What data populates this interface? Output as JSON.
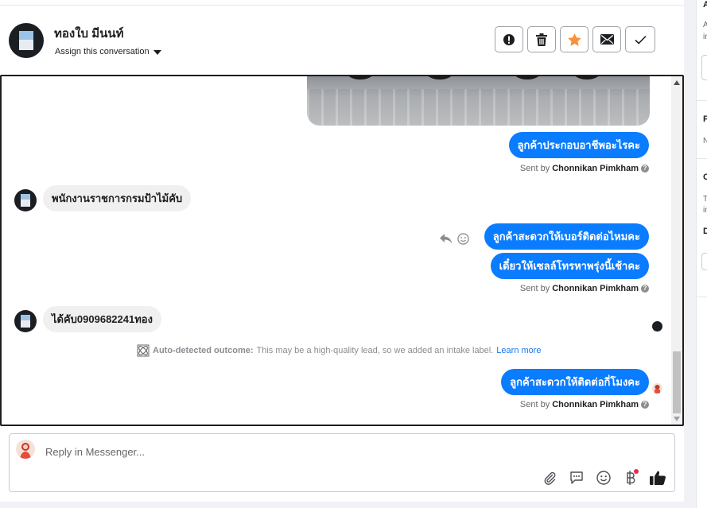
{
  "header": {
    "contact_name": "ทองใบ มีนนท์",
    "assign_label": "Assign this conversation",
    "actions": [
      {
        "name": "report-spam-button",
        "icon": "alert-circle-icon"
      },
      {
        "name": "delete-button",
        "icon": "trash-icon"
      },
      {
        "name": "star-button",
        "icon": "star-icon"
      },
      {
        "name": "mark-unread-button",
        "icon": "envelope-icon"
      },
      {
        "name": "mark-done-button",
        "icon": "check-icon"
      }
    ]
  },
  "messages": {
    "m1": "ลูกค้าประกอบอาชีพอะไรคะ",
    "m2": "พนักงานราชการกรมป้าไม้คับ",
    "m3": "ลูกค้าสะดวกให้เบอร์ติดต่อไหมคะ",
    "m4": "เดี๋ยวให้เซลล์โทรหาพรุ่งนี้เช้าคะ",
    "m5": "ได้คับ0909682241ทอง",
    "m6": "ลูกค้าสะดวกให้ติดต่อกี่โมงคะ"
  },
  "sent_by": {
    "prefix": "Sent by",
    "name": "Chonnikan Pimkham",
    "help": "?"
  },
  "auto_outcome": {
    "label": "Auto-detected outcome:",
    "text": "This may be a high-quality lead, so we added an intake label.",
    "link": "Learn more"
  },
  "composer": {
    "placeholder": "Reply in Messenger...",
    "tools": [
      "paperclip-icon",
      "speech-bubble-icon",
      "emoji-icon",
      "baht-icon",
      "thumbs-up-icon"
    ]
  },
  "side_panel": {
    "letters": [
      "A",
      "A",
      "in",
      "F",
      "N",
      "C",
      "T",
      "in",
      "D"
    ]
  },
  "colors": {
    "outgoing_bubble": "#0a7cff",
    "incoming_bubble": "#f0f0f0",
    "star": "#f7923b",
    "link": "#1877f2"
  }
}
